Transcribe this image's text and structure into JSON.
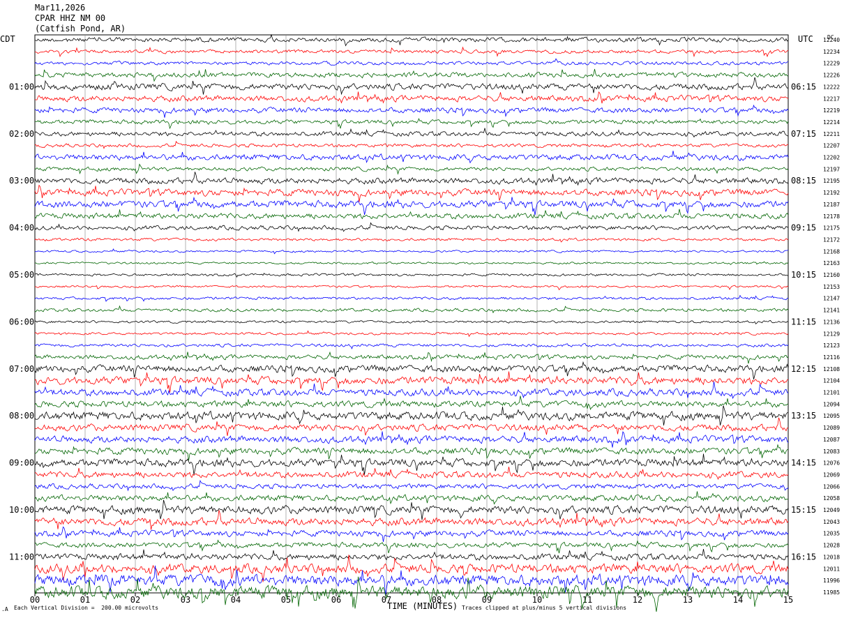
{
  "header": {
    "date": "Mar11,2026",
    "station": "CPAR HHZ NM 00",
    "location": "(Catfish Pond, AR)"
  },
  "left_tz": "CDT",
  "right_tz": "UTC",
  "dc_label": "DC",
  "colors": {
    "cycle": [
      "#000000",
      "#ff0000",
      "#0000ff",
      "#006400"
    ],
    "grid": "#808080"
  },
  "chart_data": {
    "type": "line",
    "title": "",
    "xlabel": "TIME (MINUTES)",
    "xlim": [
      0,
      15
    ],
    "x_ticks": [
      "00",
      "01",
      "02",
      "03",
      "04",
      "05",
      "06",
      "07",
      "08",
      "09",
      "10",
      "11",
      "12",
      "13",
      "14",
      "15"
    ],
    "trace_minutes": 15,
    "num_traces": 48,
    "left_hour_labels": [
      {
        "trace": 4,
        "label": "01:00"
      },
      {
        "trace": 8,
        "label": "02:00"
      },
      {
        "trace": 12,
        "label": "03:00"
      },
      {
        "trace": 16,
        "label": "04:00"
      },
      {
        "trace": 20,
        "label": "05:00"
      },
      {
        "trace": 24,
        "label": "06:00"
      },
      {
        "trace": 28,
        "label": "07:00"
      },
      {
        "trace": 32,
        "label": "08:00"
      },
      {
        "trace": 36,
        "label": "09:00"
      },
      {
        "trace": 40,
        "label": "10:00"
      },
      {
        "trace": 44,
        "label": "11:00"
      }
    ],
    "right_hour_labels": [
      {
        "trace": 4,
        "label": "06:15"
      },
      {
        "trace": 8,
        "label": "07:15"
      },
      {
        "trace": 12,
        "label": "08:15"
      },
      {
        "trace": 16,
        "label": "09:15"
      },
      {
        "trace": 20,
        "label": "10:15"
      },
      {
        "trace": 24,
        "label": "11:15"
      },
      {
        "trace": 28,
        "label": "12:15"
      },
      {
        "trace": 32,
        "label": "13:15"
      },
      {
        "trace": 36,
        "label": "14:15"
      },
      {
        "trace": 40,
        "label": "15:15"
      },
      {
        "trace": 44,
        "label": "16:15"
      }
    ],
    "dc_offsets": [
      12240,
      12234,
      12229,
      12226,
      12222,
      12217,
      12219,
      12214,
      12211,
      12207,
      12202,
      12197,
      12195,
      12192,
      12187,
      12178,
      12175,
      12172,
      12168,
      12163,
      12160,
      12153,
      12147,
      12141,
      12136,
      12129,
      12123,
      12116,
      12108,
      12104,
      12101,
      12094,
      12095,
      12089,
      12087,
      12083,
      12076,
      12069,
      12066,
      12058,
      12049,
      12043,
      12035,
      12028,
      12018,
      12011,
      11996,
      11985
    ],
    "noise_level": [
      1.3,
      1.0,
      1.0,
      1.4,
      1.8,
      1.7,
      1.5,
      1.2,
      1.3,
      1.0,
      1.7,
      1.1,
      1.7,
      1.9,
      2.0,
      1.6,
      1.2,
      0.8,
      0.6,
      0.6,
      0.7,
      0.6,
      0.8,
      0.9,
      0.7,
      0.7,
      0.9,
      1.3,
      2.0,
      2.2,
      2.0,
      1.8,
      2.4,
      1.9,
      2.0,
      1.9,
      2.2,
      1.8,
      1.4,
      1.8,
      2.3,
      2.2,
      1.7,
      1.5,
      1.8,
      2.6,
      3.2,
      3.6
    ],
    "footer_left": "Each Vertical Division =  200.00 microvolts",
    "footer_right": "Traces clipped at plus/minus 5 vertical divisions"
  }
}
